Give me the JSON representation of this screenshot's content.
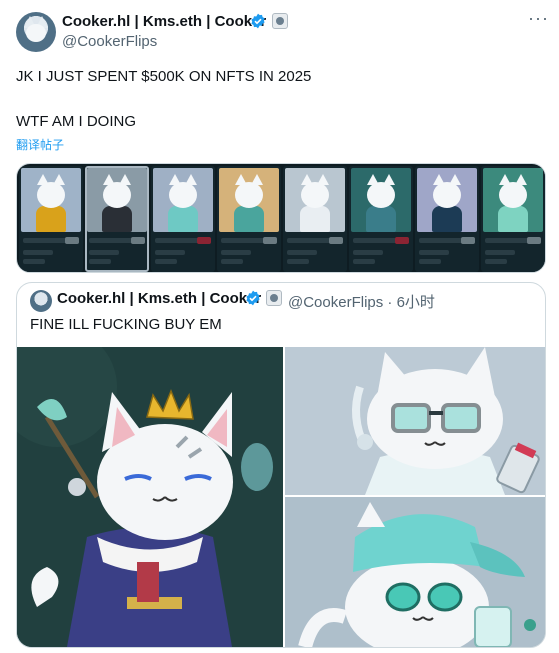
{
  "author": {
    "display_name": "Cooker.hl | Kms.eth | Cooker",
    "handle": "@CookerFlips",
    "verified_icon": "verified-badge-icon",
    "affiliate_icon": "affiliate-badge-icon"
  },
  "tweet": {
    "line1": "JK I JUST SPENT $500K ON NFTS IN 2025",
    "line2": "WTF AM I DOING",
    "translate_label": "翻译帖子",
    "more_icon": "more-options-icon"
  },
  "nft_strip": {
    "card_count": 8,
    "cards": [
      {
        "art_color": "#9fb3c8",
        "body_color": "#d9a21b"
      },
      {
        "art_color": "#8a9ba6",
        "body_color": "#2a2f36"
      },
      {
        "art_color": "#9fb0c5",
        "body_color": "#6ec9c4"
      },
      {
        "art_color": "#d5b27a",
        "body_color": "#4aa59d"
      },
      {
        "art_color": "#b9c6d0",
        "body_color": "#e9eef2"
      },
      {
        "art_color": "#2c6a6a",
        "body_color": "#3a7d8a"
      },
      {
        "art_color": "#9fa6c8",
        "body_color": "#1c3b55"
      },
      {
        "art_color": "#3c8a7d",
        "body_color": "#7ed3c1"
      }
    ]
  },
  "quote": {
    "display_name": "Cooker.hl | Kms.eth | Cooker",
    "handle_time": "@CookerFlips · 6小时",
    "text": "FINE ILL FUCKING BUY EM"
  },
  "colors": {
    "link": "#1d9bf0",
    "verified": "#1d9bf0",
    "secondary_text": "#536471",
    "border": "#cfd9de"
  }
}
